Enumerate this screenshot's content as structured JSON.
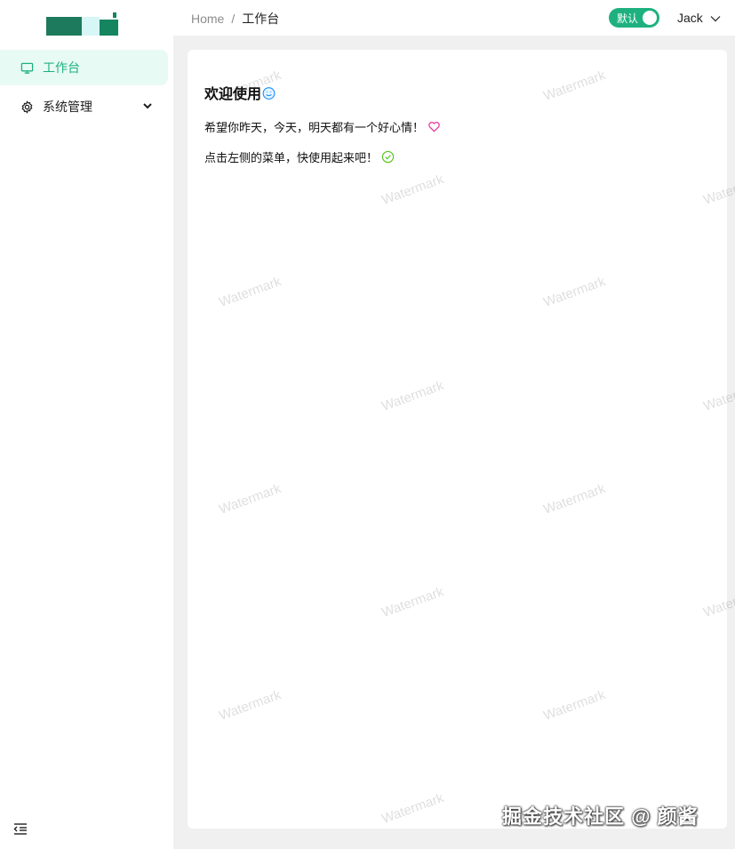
{
  "sidebar": {
    "items": [
      {
        "label": "工作台",
        "icon": "monitor-icon",
        "active": true
      },
      {
        "label": "系统管理",
        "icon": "gear-icon",
        "expandable": true
      }
    ],
    "collapse_icon": "menu-fold-icon"
  },
  "header": {
    "breadcrumb": {
      "home": "Home",
      "separator": "/",
      "current": "工作台"
    },
    "theme_toggle": {
      "label": "默认",
      "on": true
    },
    "user_name": "Jack"
  },
  "content": {
    "title": "欢迎使用",
    "line1": "希望你昨天，今天，明天都有一个好心情！",
    "line2": "点击左侧的菜单，快使用起来吧！"
  },
  "watermark": "Watermark",
  "stamp": "掘金技术社区 @ 颜酱",
  "colors": {
    "accent": "#1eb17f",
    "active_bg": "#e8faf4",
    "page_bg": "#f0f0f0",
    "heart": "#eb2f96",
    "check": "#52c41a",
    "smile": "#1890ff"
  }
}
